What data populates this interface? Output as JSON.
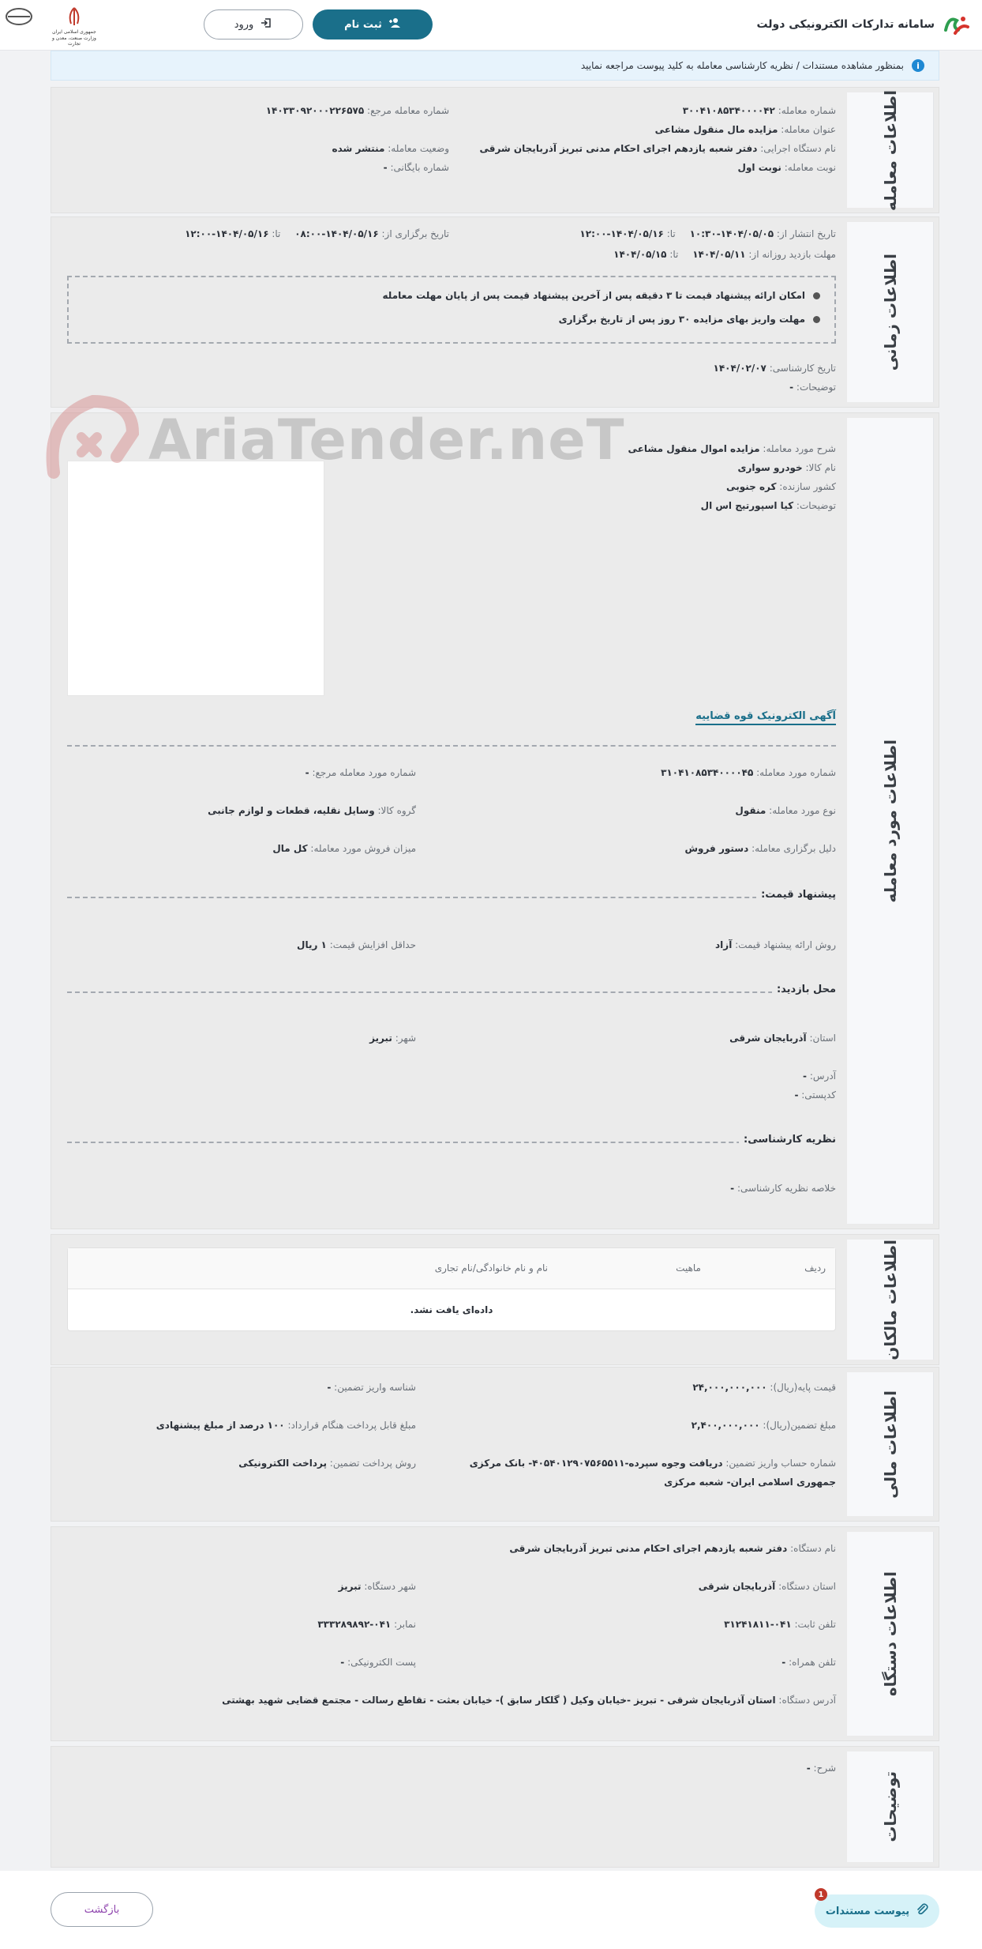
{
  "header": {
    "site_title": "سامانه تدارکات الکترونیکی دولت",
    "register_label": "ثبت نام",
    "login_label": "ورود",
    "gov_emblem_text": "جمهوری اسلامی ایران\nوزارت صنعت، معدن و تجارت"
  },
  "notice": {
    "icon": "info-icon",
    "text": "بمنظور مشاهده مستندات / نظریه کارشناسی معامله به کلید پیوست مراجعه نمایید"
  },
  "deal_info": {
    "title": "اطلاعات معامله",
    "number_label": "شماره معامله:",
    "number": "۳۰۰۴۱۰۸۵۳۴۰۰۰۰۴۲",
    "ref_label": "شماره معامله مرجع:",
    "ref": "۱۴۰۳۳۰۹۲۰۰۰۲۲۶۵۷۵",
    "subject_label": "عنوان معامله:",
    "subject": "مزایده مال منقول مشاعی",
    "status_label": "وضعیت معامله:",
    "status": "منتشر شده",
    "executor_label": "نام دستگاه اجرایی:",
    "executor": "دفتر شعبه یازدهم اجرای احکام مدنی تبریز آذربایجان شرقی",
    "archive_label": "شماره بایگانی:",
    "archive": "-",
    "round_label": "نوبت معامله:",
    "round": "نوبت اول"
  },
  "time_info": {
    "title": "اطلاعات زمانی",
    "publish_label": "تاریخ انتشار از:",
    "publish_from": "۱۴۰۴/۰۵/۰۵-۱۰:۳۰",
    "to_label": "تا:",
    "publish_to": "۱۴۰۴/۰۵/۱۶-۱۲:۰۰",
    "hold_label": "تاریخ برگزاری از:",
    "hold_from": "۱۴۰۴/۰۵/۱۶-۰۸:۰۰",
    "hold_to": "۱۴۰۴/۰۵/۱۶-۱۲:۰۰",
    "visit_label": "مهلت بازدید روزانه از:",
    "visit_from": "۱۴۰۴/۰۵/۱۱",
    "visit_to": "۱۴۰۴/۰۵/۱۵",
    "bullets": [
      "امکان ارائه پیشنهاد قیمت تا ۳ دقیقه پس از آخرین پیشنهاد قیمت پس از پایان مهلت معامله",
      "مهلت واریز بهای مزایده ۳۰ روز پس از تاریخ برگزاری"
    ],
    "expert_date_label": "تاریخ کارشناسی:",
    "expert_date": "۱۴۰۴/۰۲/۰۷",
    "desc_label": "توضیحات:",
    "desc": "-"
  },
  "item_info": {
    "title": "اطلاعات مورد معامله",
    "watermark": "AriaTender.neT",
    "desc_label": "شرح مورد معامله:",
    "desc": "مزایده اموال منقول مشاعی",
    "goods_label": "نام کالا:",
    "goods": "خودرو سواری",
    "country_label": "کشور سازنده:",
    "country": "کره جنوبی",
    "notes_label": "توضیحات:",
    "notes": "کیا اسپورتیج اس ال",
    "ad_link": "آگهی الکترونیک قوه قضاییه",
    "item_no_label": "شماره مورد معامله:",
    "item_no": "۳۱۰۴۱۰۸۵۳۴۰۰۰۰۴۵",
    "item_ref_label": "شماره مورد معامله مرجع:",
    "item_ref": "-",
    "type_label": "نوع مورد معامله:",
    "type": "منقول",
    "group_label": "گروه کالا:",
    "group": "وسایل نقلیه، قطعات و لوازم جانبی",
    "reason_label": "دلیل برگزاری معامله:",
    "reason": "دستور فروش",
    "sale_label": "میزان فروش مورد معامله:",
    "sale": "کل مال",
    "bid_head": "پیشنهاد قیمت:",
    "bid_method_label": "روش ارائه پیشنهاد قیمت:",
    "bid_method": "آزاد",
    "min_inc_label": "حداقل افزایش قیمت:",
    "min_inc": "۱ ریال",
    "visit_head": "محل بازدید:",
    "province_label": "استان:",
    "province": "آذربایجان شرقی",
    "city_label": "شهر:",
    "city": "تبریز",
    "address_label": "آدرس:",
    "address": "-",
    "postal_label": "کدپستی:",
    "postal": "-",
    "expert_head": "نظریه کارشناسی:",
    "expert_summary_label": "خلاصه نظریه کارشناسی:",
    "expert_summary": "-"
  },
  "owners": {
    "title": "اطلاعات مالکان",
    "col_row": "ردیف",
    "col_nature": "ماهیت",
    "col_name": "نام و نام خانوادگی/نام تجاری",
    "empty": "داده‌ای یافت نشد."
  },
  "finance": {
    "title": "اطلاعات مالی",
    "base_label": "قیمت پایه(ریال):",
    "base": "۲۴,۰۰۰,۰۰۰,۰۰۰",
    "deposit_id_label": "شناسه واریز تضمین:",
    "deposit_id": "-",
    "guarantee_label": "مبلغ تضمین(ریال):",
    "guarantee": "۲,۴۰۰,۰۰۰,۰۰۰",
    "payable_label": "مبلغ قابل پرداخت هنگام قرارداد:",
    "payable": "۱۰۰ درصد از مبلغ پیشنهادی",
    "account_label": "شماره حساب واریز تضمین:",
    "account_line1": "دریافت وجوه سپرده-۴۰۵۴۰۱۲۹۰۷۵۶۵۵۱۱- بانک مرکزی",
    "account_line2": "جمهوری اسلامی ایران- شعبه مرکزی",
    "pay_method_label": "روش پرداخت تضمین:",
    "pay_method": "پرداخت الکترونیکی"
  },
  "org": {
    "title": "اطلاعات دستگاه",
    "name_label": "نام دستگاه:",
    "name": "دفتر شعبه یازدهم اجرای احکام مدنی تبریز آذربایجان شرقی",
    "province_label": "استان دستگاه:",
    "province": "آذربایجان شرقی",
    "city_label": "شهر دستگاه:",
    "city": "تبریز",
    "phone_label": "تلفن ثابت:",
    "phone": "۰۴۱-۳۱۲۴۱۸۱۱",
    "fax_label": "نمابر:",
    "fax": "۰۴۱-۳۳۳۲۸۹۸۹۲",
    "mobile_label": "تلفن همراه:",
    "mobile": "-",
    "email_label": "پست الکترونیکی:",
    "email": "-",
    "address_label": "آدرس دستگاه:",
    "address": "استان آذربایجان شرقی - تبریز -خیابان وکیل ( گلکار سابق )- خیابان بعثت - تقاطع رسالت - مجتمع قضایی شهید بهشتی"
  },
  "descriptions": {
    "title": "توضیحات",
    "desc_label": "شرح:",
    "desc": "-"
  },
  "footer": {
    "docs_label": "پیوست مستندات",
    "docs_badge": "1",
    "back_label": "بازگشت"
  }
}
